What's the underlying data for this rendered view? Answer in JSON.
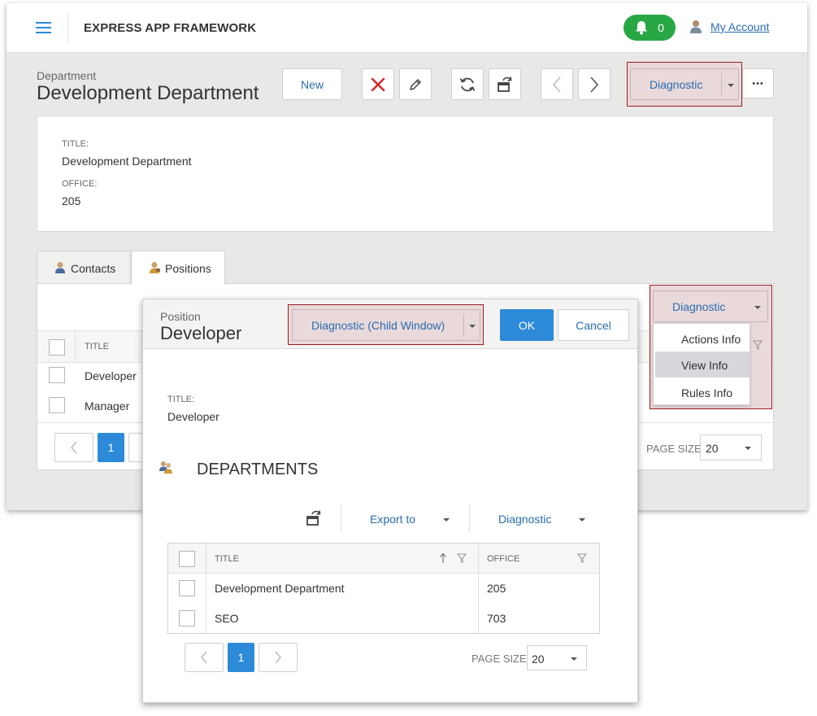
{
  "header": {
    "app_title": "EXPRESS APP FRAMEWORK",
    "notification_count": "0",
    "account_label": "My Account"
  },
  "detail": {
    "caption": "Department",
    "title": "Development Department",
    "toolbar": {
      "new_label": "New",
      "diagnostic_label": "Diagnostic",
      "more_label": "•••"
    },
    "fields": [
      {
        "label": "TITLE:",
        "value": "Development Department"
      },
      {
        "label": "OFFICE:",
        "value": "205"
      }
    ]
  },
  "tabs": [
    {
      "label": "Contacts"
    },
    {
      "label": "Positions"
    }
  ],
  "positions_grid": {
    "header_title": "TITLE",
    "rows": [
      "Developer",
      "Manager"
    ],
    "diagnostic_label": "Diagnostic",
    "menu_items": [
      "Actions Info",
      "View Info",
      "Rules Info"
    ],
    "page": "1",
    "page_size_label": "PAGE SIZE",
    "page_size": "20"
  },
  "popup": {
    "caption": "Position",
    "title": "Developer",
    "diagnostic_label": "Diagnostic (Child Window)",
    "ok_label": "OK",
    "cancel_label": "Cancel",
    "field_label": "TITLE:",
    "field_value": "Developer",
    "section_title": "DEPARTMENTS",
    "export_label": "Export to",
    "diagnostic2_label": "Diagnostic",
    "grid": {
      "col_title": "TITLE",
      "col_office": "OFFICE",
      "rows": [
        {
          "title": "Development Department",
          "office": "205"
        },
        {
          "title": "SEO",
          "office": "703"
        }
      ]
    },
    "page": "1",
    "page_size_label": "PAGE SIZE",
    "page_size": "20"
  },
  "colors": {
    "accent": "#2d8ad8",
    "success": "#28a745",
    "highlight_border": "#9b1c24",
    "highlight_fill": "#e9d9da",
    "delete_red": "#d22c2c"
  }
}
